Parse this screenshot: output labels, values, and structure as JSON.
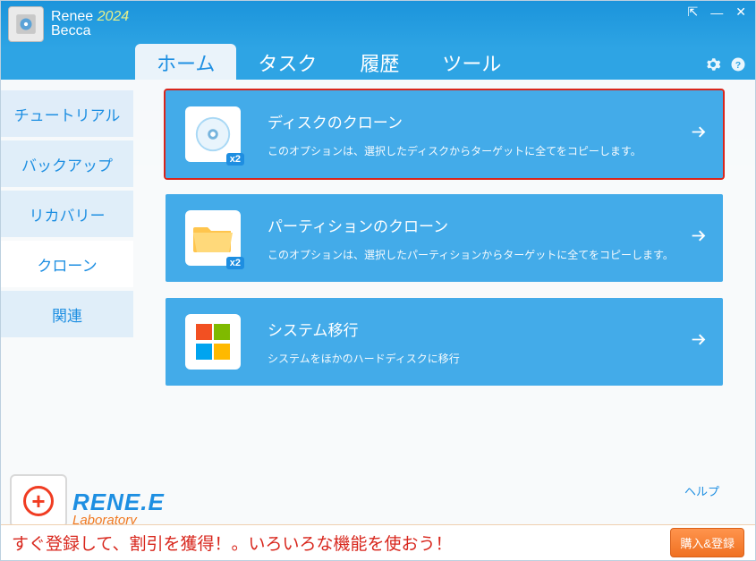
{
  "appName": "Renee",
  "appYear": "2024",
  "appSub": "Becca",
  "tabs": {
    "home": "ホーム",
    "task": "タスク",
    "history": "履歴",
    "tool": "ツール"
  },
  "sidebar": {
    "tutorial": "チュートリアル",
    "backup": "バックアップ",
    "recovery": "リカバリー",
    "clone": "クローン",
    "related": "関連"
  },
  "cards": {
    "disk": {
      "title": "ディスクのクローン",
      "desc": "このオプションは、選択したディスクからターゲットに全てをコピーします。",
      "badge": "x2"
    },
    "partition": {
      "title": "パーティションのクローン",
      "desc": "このオプションは、選択したパーティションからターゲットに全てをコピーします。",
      "badge": "x2"
    },
    "system": {
      "title": "システム移行",
      "desc": "システムをほかのハードディスクに移行"
    }
  },
  "helpLink": "ヘルプ",
  "footerBrand": {
    "rene": "RENE.E",
    "lab": "Laboratory"
  },
  "promo": "すぐ登録して、割引を獲得！。いろいろな機能を使おう！",
  "buyBtn": "購入&登録"
}
